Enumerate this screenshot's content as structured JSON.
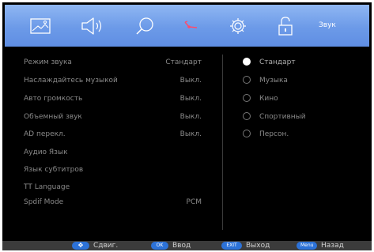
{
  "menu": {
    "icons": [
      "picture-icon",
      "speaker-icon",
      "search-icon",
      "satellite-dish-icon",
      "gear-icon",
      "lock-icon"
    ],
    "active_title": "Звук"
  },
  "settings": [
    {
      "label": "Режим звука",
      "value": "Стандарт"
    },
    {
      "label": "Наслаждайтесь музыкой",
      "value": "Выкл."
    },
    {
      "label": "Авто громкость",
      "value": "Выкл."
    },
    {
      "label": "Объемный звук",
      "value": "Выкл."
    },
    {
      "label": "AD перекл.",
      "value": "Выкл."
    },
    {
      "label": "Аудио Язык",
      "value": ""
    },
    {
      "label": "Язык субтитров",
      "value": ""
    },
    {
      "label": "TT Language",
      "value": ""
    },
    {
      "label": "Spdif Mode",
      "value": "PCM"
    }
  ],
  "sound_modes": [
    {
      "label": "Стандарт",
      "selected": true
    },
    {
      "label": "Музыка",
      "selected": false
    },
    {
      "label": "Кино",
      "selected": false
    },
    {
      "label": "Спортивный",
      "selected": false
    },
    {
      "label": "Персон.",
      "selected": false
    }
  ],
  "help_bar": [
    {
      "key": "✥",
      "label": "Сдвиг."
    },
    {
      "key": "OK",
      "label": "Ввод"
    },
    {
      "key": "EXIT",
      "label": "Выход"
    },
    {
      "key": "Menu",
      "label": "Назад"
    }
  ],
  "colors": {
    "topbar": "#6c9ae8",
    "background": "#000000",
    "key_badge": "#2c72d8",
    "text": "#8a8a8a"
  }
}
